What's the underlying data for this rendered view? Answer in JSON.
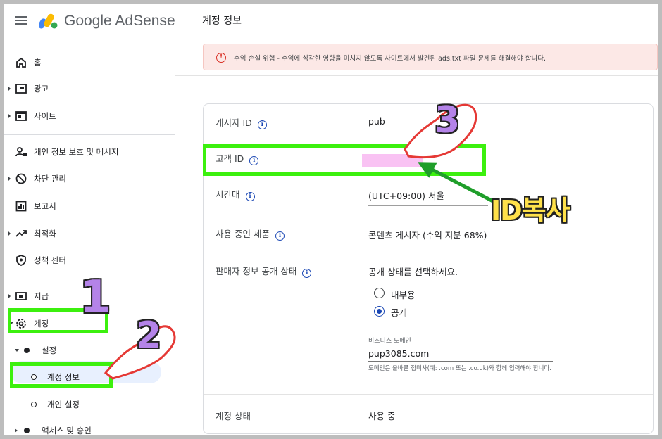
{
  "header": {
    "brand": "Google AdSense",
    "page_title": "계정 정보"
  },
  "sidebar": {
    "items": [
      {
        "label": "홈",
        "icon": "home-icon"
      },
      {
        "label": "광고",
        "icon": "ads-icon"
      },
      {
        "label": "사이트",
        "icon": "sites-icon"
      },
      {
        "label": "개인 정보 보호 및 메시지",
        "icon": "privacy-messaging-icon"
      },
      {
        "label": "차단 관리",
        "icon": "block-icon"
      },
      {
        "label": "보고서",
        "icon": "reports-icon"
      },
      {
        "label": "최적화",
        "icon": "trending-icon"
      },
      {
        "label": "정책 센터",
        "icon": "policy-shield-icon"
      },
      {
        "label": "지급",
        "icon": "payments-icon"
      },
      {
        "label": "계정",
        "icon": "gear-icon"
      }
    ],
    "sub": {
      "settings": "설정",
      "account_info": "계정 정보",
      "personal_settings": "개인 설정",
      "access_auth": "액세스 및 승인"
    }
  },
  "alert": {
    "text": "수익 손실 위험 - 수익에 심각한 영향을 미치지 않도록 사이트에서 발견된 ads.txt 파일 문제를 해결해야 합니다."
  },
  "account": {
    "publisher_id_label": "게시자 ID",
    "publisher_id_value": "pub-",
    "customer_id_label": "고객 ID",
    "timezone_label": "시간대",
    "timezone_value": "(UTC+09:00) 서울",
    "products_label": "사용 중인 제품",
    "products_value": "콘텐츠 게시자 (수익 지분 68%)",
    "disclosure_label": "판매자 정보 공개 상태",
    "disclosure_prompt": "공개 상태를 선택하세요.",
    "radio_internal": "내부용",
    "radio_public": "공개",
    "selected_option": "공개",
    "domain_label": "비즈니스 도메인",
    "domain_value": "pup3085.com",
    "domain_helper": "도메인은 올바른 접미사(예: .com 또는 .co.uk)와 함께 입력해야 합니다.",
    "status_label": "계정 상태",
    "status_value": "사용 중"
  },
  "annotations": {
    "step1": "1",
    "step2": "2",
    "step3": "3",
    "copy_label": "ID복사",
    "highlight_color": "#3cf00e",
    "arrow_color": "#1f9e2a",
    "number_color": "#b483e8",
    "label_color": "#ffe14a"
  }
}
